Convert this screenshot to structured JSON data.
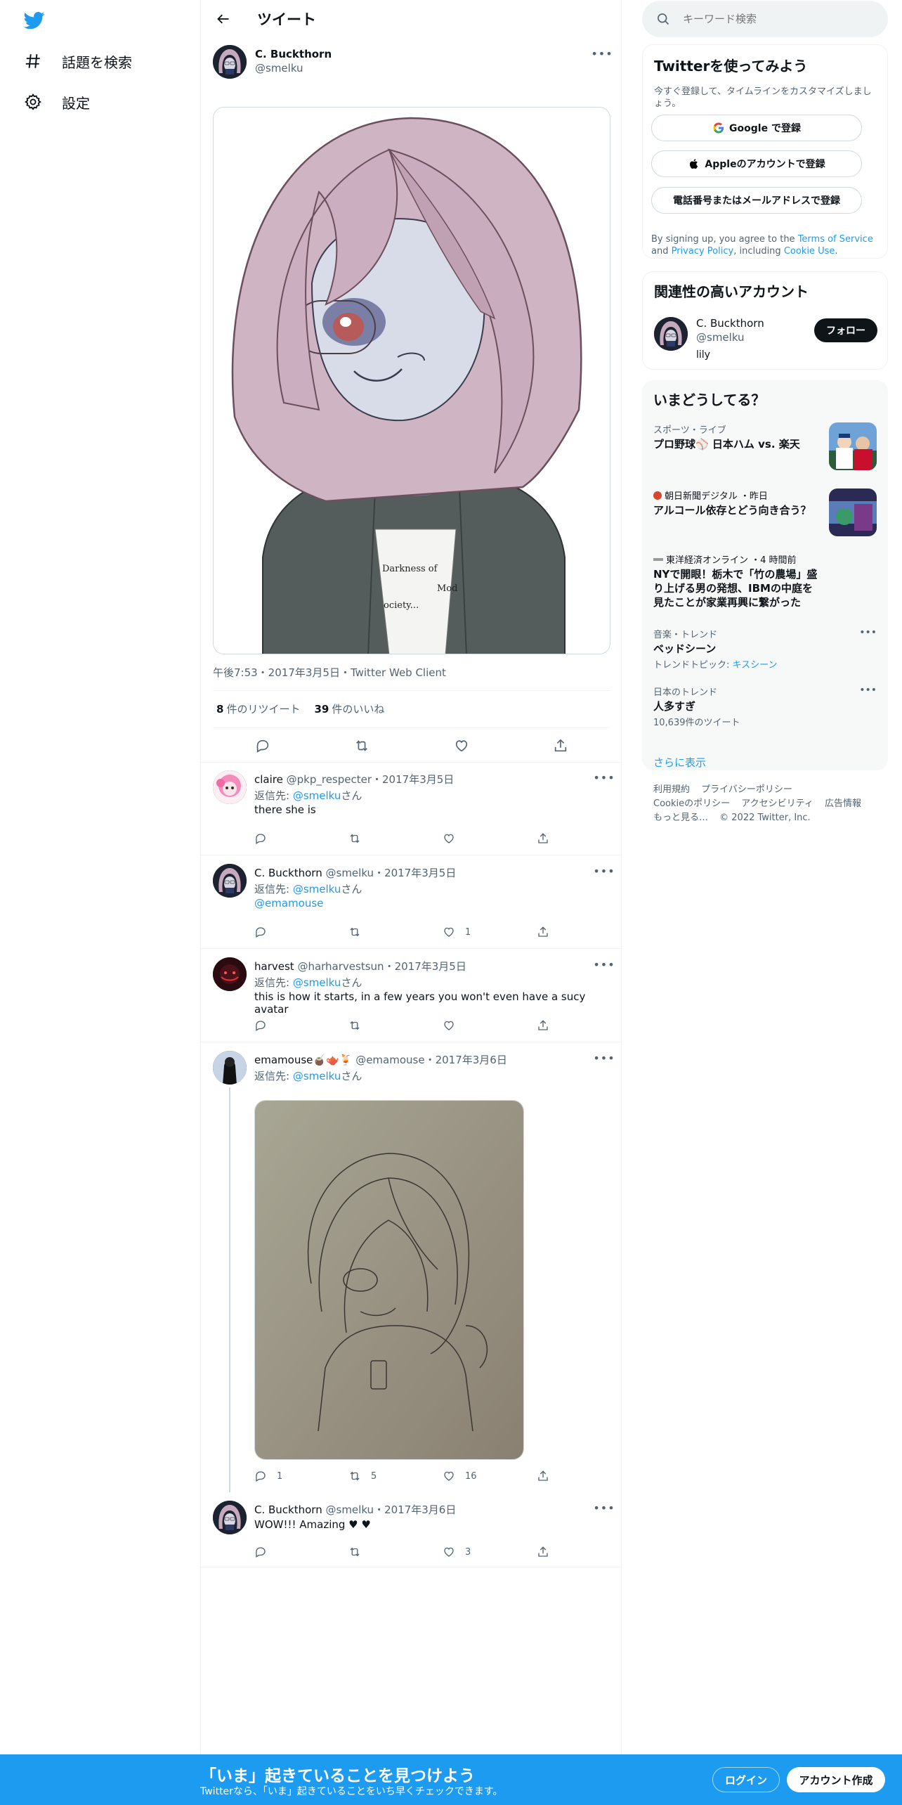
{
  "nav": {
    "logo": "twitter-bird-icon",
    "items": [
      {
        "label": "話題を検索",
        "icon": "hashtag-icon"
      },
      {
        "label": "設定",
        "icon": "gear-icon"
      }
    ]
  },
  "header": {
    "title": "ツイート"
  },
  "tweet": {
    "name": "C. Buckthorn",
    "handle": "@smelku",
    "image_text": [
      "Darkness of",
      "Mod",
      "ociety..."
    ],
    "meta": "午後7:53・2017年3月5日・Twitter Web Client",
    "retweets_count": "8",
    "retweets_label": "件のリツイート",
    "likes_count": "39",
    "likes_label": "件のいいね"
  },
  "replies": [
    {
      "name": "claire",
      "handle": "@pkp_respecter",
      "date": "・2017年3月5日",
      "reply_prefix": "返信先: ",
      "reply_to": "@smelku",
      "reply_suffix": "さん",
      "text": "there she is",
      "counts": [
        "",
        "",
        "",
        ""
      ]
    },
    {
      "name": "C. Buckthorn",
      "handle": "@smelku",
      "date": "・2017年3月5日",
      "reply_prefix": "返信先: ",
      "reply_to": "@smelku",
      "reply_suffix": "さん",
      "mention": "@emamouse",
      "counts": [
        "",
        "",
        "1",
        ""
      ]
    },
    {
      "name": "harvest",
      "handle": "@harharvestsun",
      "date": "・2017年3月5日",
      "reply_prefix": "返信先: ",
      "reply_to": "@smelku",
      "reply_suffix": "さん",
      "text": "this is how it starts, in a few years you won't even have a sucy avatar",
      "counts": [
        "",
        "",
        "",
        ""
      ]
    },
    {
      "name": "emamouse🧉🫖🍹",
      "handle": "@emamouse",
      "date": "・2017年3月6日",
      "reply_prefix": "返信先: ",
      "reply_to": "@smelku",
      "reply_suffix": "さん",
      "counts": [
        "1",
        "5",
        "16",
        ""
      ]
    },
    {
      "name": "C. Buckthorn",
      "handle": "@smelku",
      "date": "・2017年3月6日",
      "text": "WOW!!! Amazing ♥ ♥",
      "counts": [
        "",
        "",
        "3",
        ""
      ]
    }
  ],
  "search": {
    "placeholder": "キーワード検索"
  },
  "signup": {
    "title": "Twitterを使ってみよう",
    "subtitle": "今すぐ登録して、タイムラインをカスタマイズしましょう。",
    "google": "Google で登録",
    "apple": "Appleのアカウントで登録",
    "phone": "電話番号またはメールアドレスで登録",
    "terms_1": "By signing up, you agree to the ",
    "terms_link1": "Terms of Service",
    "terms_2": " and ",
    "terms_link2": "Privacy Policy",
    "terms_3": ", including ",
    "terms_link3": "Cookie Use",
    "terms_4": "."
  },
  "related": {
    "title": "関連性の高いアカウント",
    "name": "C. Buckthorn",
    "handle": "@smelku",
    "bio": "lily",
    "follow": "フォロー"
  },
  "trends": {
    "title": "いまどうしてる？",
    "items": [
      {
        "category": "スポーツ・ライブ",
        "title": "プロ野球⚾ 日本ハム vs. 楽天"
      },
      {
        "category": "朝日新聞デジタル ・昨日",
        "title": "アルコール依存とどう向き合う？"
      },
      {
        "category": "東洋経済オンライン ・4 時間前",
        "title": "NYで開眼！栃木で「竹の農場」盛り上げる男の発想、IBMの中庭を見たことが家業再興に繋がった"
      },
      {
        "category": "音楽・トレンド",
        "title": "ベッドシーン",
        "sub_prefix": "トレンドトピック: ",
        "sub_link": "キスシーン"
      },
      {
        "category": "日本のトレンド",
        "title": "人多すぎ",
        "sub": "10,639件のツイート"
      }
    ],
    "show_more": "さらに表示"
  },
  "footer": {
    "links": [
      "利用規約",
      "プライバシーポリシー",
      "Cookieのポリシー",
      "アクセシビリティ",
      "広告情報",
      "もっと見る…",
      "© 2022 Twitter, Inc."
    ]
  },
  "bottombar": {
    "title": "「いま」起きていることを見つけよう",
    "subtitle": "Twitterなら、「いま」起きていることをいち早くチェックできます。",
    "login": "ログイン",
    "signup": "アカウント作成"
  },
  "colors": {
    "accent": "#1d9bf0",
    "text": "#0f1419",
    "secondary": "#536471",
    "heart": "#e0245e"
  }
}
